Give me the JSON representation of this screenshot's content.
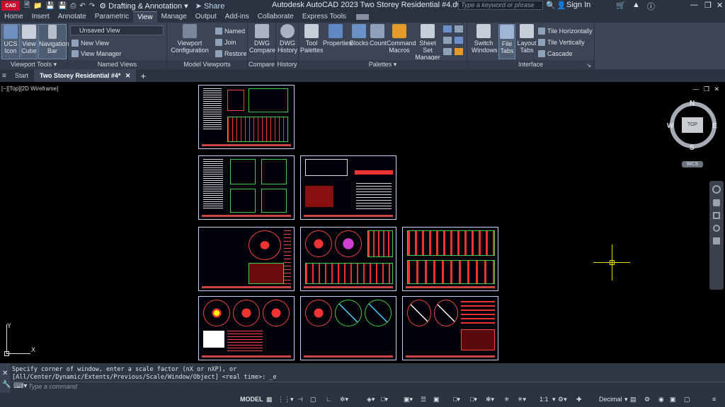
{
  "app": {
    "logo_label": "CAD",
    "title": "Autodesk AutoCAD 2023   Two Storey Residential #4.dwg",
    "workspace": "Drafting & Annotation",
    "share": "Share",
    "search_placeholder": "Type a keyword or phrase",
    "sign_in": "Sign In"
  },
  "menu_tabs": [
    "Home",
    "Insert",
    "Annotate",
    "Parametric",
    "View",
    "Manage",
    "Output",
    "Add-ins",
    "Collaborate",
    "Express Tools"
  ],
  "active_tab": "View",
  "ribbon": {
    "viewport_tools": {
      "title": "Viewport Tools",
      "ucs": "UCS Icon",
      "viewcube": "View Cube",
      "navbar": "Navigation Bar"
    },
    "named_views": {
      "title": "Named Views",
      "dropdown": "Unsaved View",
      "new_view": "New View",
      "view_manager": "View Manager"
    },
    "model_viewports": {
      "title": "Model Viewports",
      "config": "Viewport Configuration",
      "named": "Named",
      "join": "Join",
      "restore": "Restore"
    },
    "compare": {
      "title": "Compare",
      "dwg_compare": "DWG Compare"
    },
    "history": {
      "title": "History",
      "dwg_history": "DWG History"
    },
    "palettes": {
      "title": "Palettes",
      "items": [
        "Tool Palettes",
        "Properties",
        "Blocks",
        "Count",
        "Command Macros",
        "Sheet Set Manager"
      ]
    },
    "interface": {
      "title": "Interface",
      "switch": "Switch Windows",
      "file_tabs": "File Tabs",
      "layout_tabs": "Layout Tabs",
      "tile_h": "Tile Horizontally",
      "tile_v": "Tile Vertically",
      "cascade": "Cascade"
    }
  },
  "doc_tabs": {
    "start": "Start",
    "active": "Two Storey Residential #4*"
  },
  "viewport": {
    "label": "[−][Top][2D Wireframe]",
    "viewcube": {
      "n": "N",
      "s": "S",
      "e": "E",
      "w": "W",
      "face": "TOP",
      "wcs": "WCS"
    },
    "ucs_x": "X",
    "ucs_y": "Y"
  },
  "command": {
    "line1": "Specify corner of window, enter a scale factor (nX or nXP), or",
    "line2": "[All/Center/Dynamic/Extents/Previous/Scale/Window/Object] <real time>: _e",
    "placeholder": "Type a command"
  },
  "status": {
    "model": "MODEL",
    "scale": "1:1",
    "units": "Decimal"
  },
  "colors": {
    "chrome": "#2b3341",
    "ribbon": "#3c4556",
    "accent": "#c8102e",
    "crosshair": "#e5e000"
  }
}
